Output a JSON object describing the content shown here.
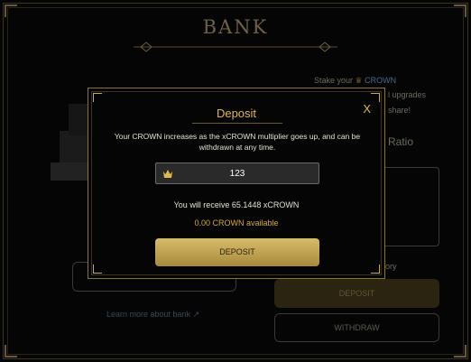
{
  "page": {
    "title": "BANK"
  },
  "background": {
    "stake_prefix": "Stake your",
    "stake_token": "CROWN",
    "upgrades_fragment": "l upgrades",
    "share_fragment": "share!",
    "ratio_fragment": "Ratio",
    "history_fragment": "story",
    "learn_more": "Learn more about bank",
    "deposit_label": "DEPOSIT",
    "withdraw_label": "WITHDRAW"
  },
  "modal": {
    "title": "Deposit",
    "close_label": "X",
    "description": "Your CROWN increases as the xCROWN multiplier goes up, and can be withdrawn at any time.",
    "amount_value": "123",
    "receive_text": "You will receive 65.1448 xCROWN",
    "available_text": "0.00 CROWN available",
    "deposit_button_label": "DEPOSIT"
  },
  "icons": {
    "crown": "crown-icon",
    "close": "close-icon",
    "external_link": "external-link-icon"
  },
  "colors": {
    "gold_accent": "#e0b94c",
    "button_gold": "#d8bb6a",
    "link_blue": "#4a6a8a"
  }
}
